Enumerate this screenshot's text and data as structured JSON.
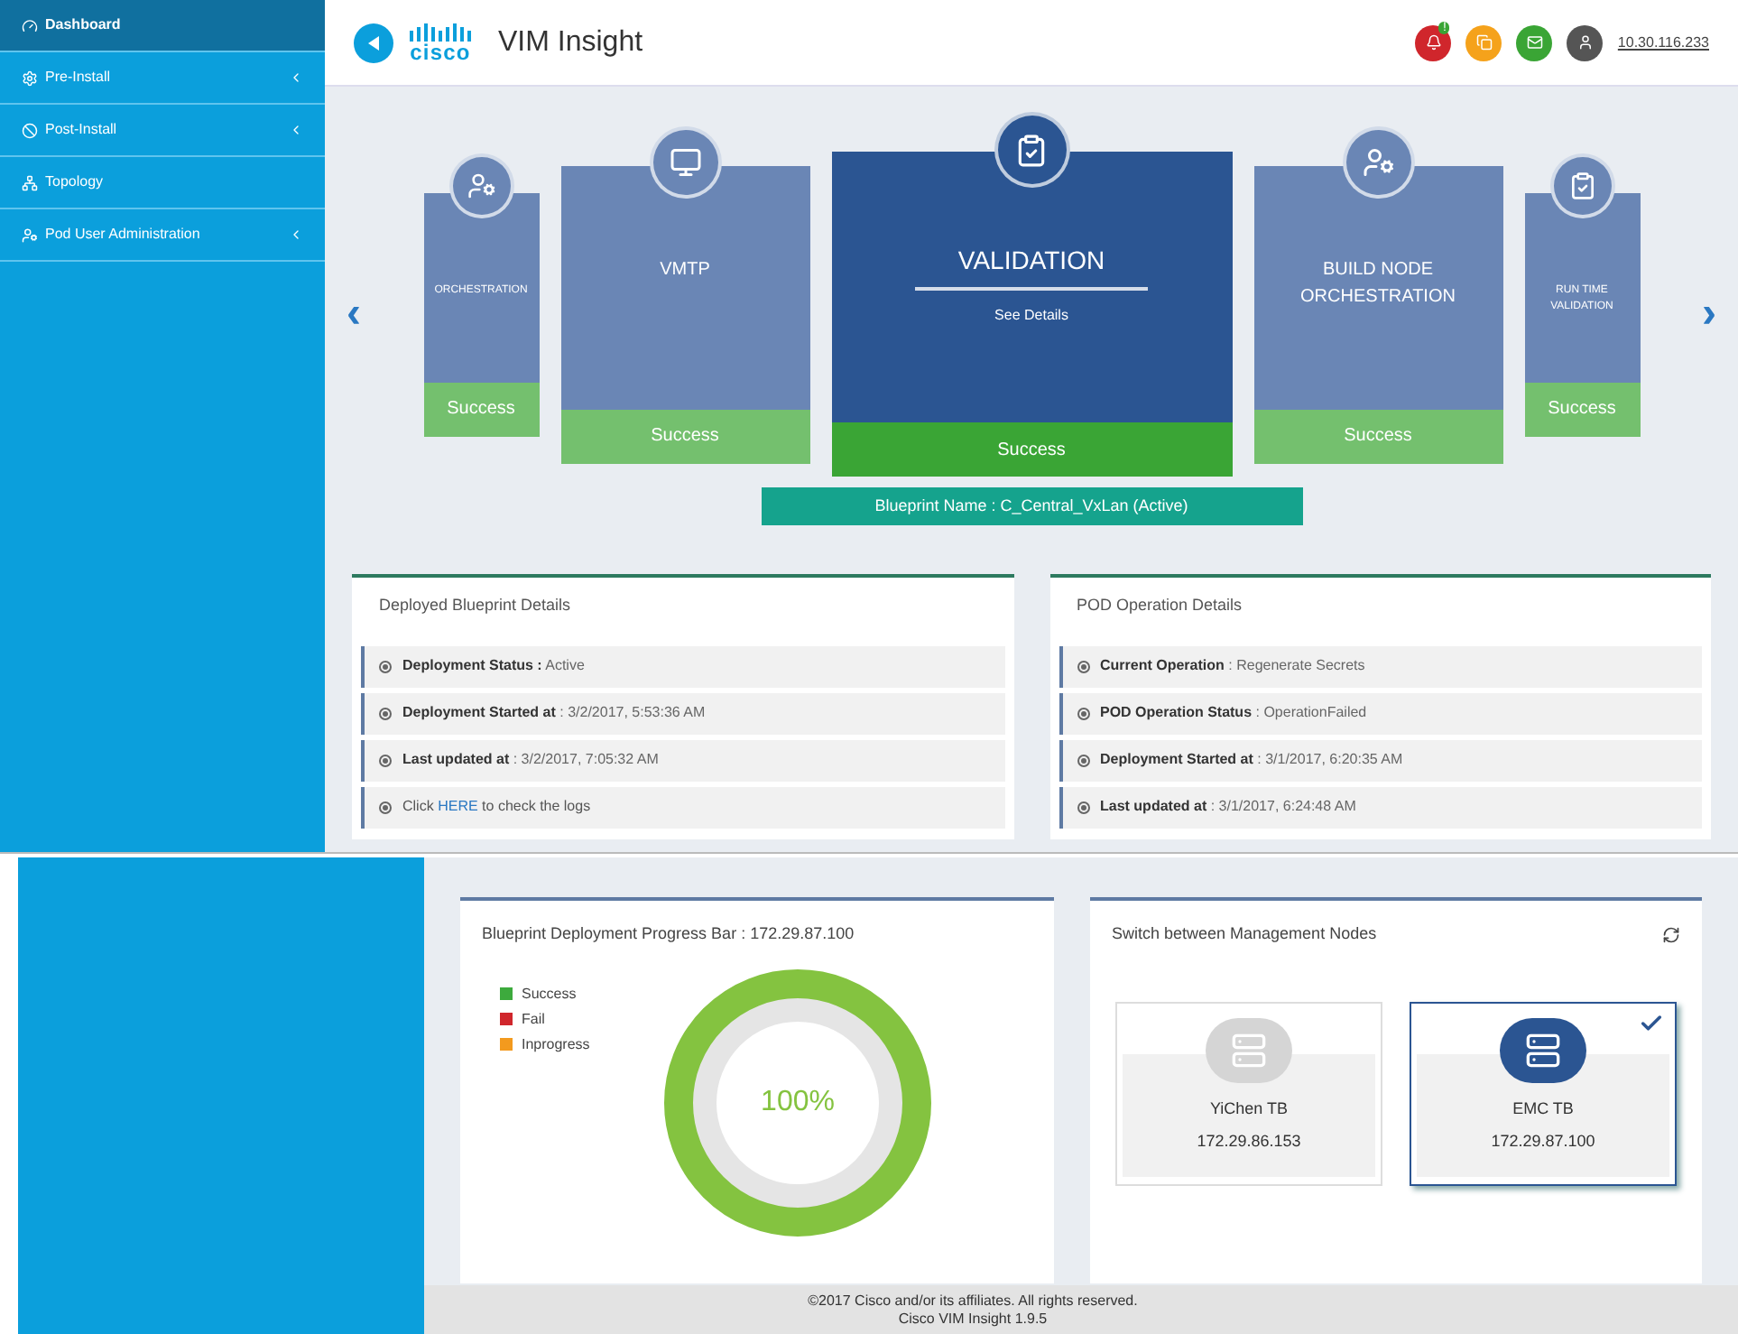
{
  "sidebar": {
    "items": [
      {
        "label": "Dashboard",
        "selected": true,
        "expandable": false
      },
      {
        "label": "Pre-Install",
        "selected": false,
        "expandable": true
      },
      {
        "label": "Post-Install",
        "selected": false,
        "expandable": true
      },
      {
        "label": "Topology",
        "selected": false,
        "expandable": false
      },
      {
        "label": "Pod User Administration",
        "selected": false,
        "expandable": true
      }
    ]
  },
  "header": {
    "logo_text": "cisco",
    "title": "VIM Insight",
    "notification_count": "!",
    "ip": "10.30.116.233"
  },
  "carousel": {
    "prev": "‹",
    "next": "›",
    "stages": [
      {
        "name": "ORCHESTRATION",
        "status": "Success",
        "kind": "small",
        "selected": false
      },
      {
        "name": "VMTP",
        "status": "Success",
        "kind": "medium",
        "selected": false
      },
      {
        "name": "VALIDATION",
        "status": "Success",
        "kind": "large",
        "selected": true,
        "link": "See Details"
      },
      {
        "name": "BUILD NODE ORCHESTRATION",
        "status": "Success",
        "kind": "medium",
        "selected": false
      },
      {
        "name": "RUN TIME VALIDATION",
        "status": "Success",
        "kind": "small",
        "selected": false
      }
    ],
    "blueprint": "Blueprint Name : C_Central_VxLan (Active)"
  },
  "panels": [
    {
      "title": "Deployed Blueprint Details",
      "rows": [
        {
          "kind": "field",
          "label": "Deployment Status :",
          "value": "Active"
        },
        {
          "kind": "field",
          "label": "Deployment Started at",
          "value": ": 3/2/2017, 5:53:36 AM"
        },
        {
          "kind": "field",
          "label": "Last updated at",
          "value": ": 3/2/2017, 7:05:32 AM"
        },
        {
          "kind": "link",
          "before": "Click",
          "link": "HERE",
          "after": "to check the logs"
        }
      ]
    },
    {
      "title": "POD Operation Details",
      "rows": [
        {
          "kind": "field",
          "label": "Current Operation",
          "value": ": Regenerate Secrets"
        },
        {
          "kind": "field",
          "label": "POD Operation Status",
          "value": ": OperationFailed"
        },
        {
          "kind": "field",
          "label": "Deployment Started at",
          "value": ": 3/1/2017, 6:20:35 AM"
        },
        {
          "kind": "field",
          "label": "Last updated at",
          "value": ": 3/1/2017, 6:24:48 AM"
        }
      ]
    }
  ],
  "progress": {
    "title": "Blueprint Deployment Progress Bar : 172.29.87.100",
    "legend": [
      {
        "label": "Success",
        "color": "#3daa3d"
      },
      {
        "label": "Fail",
        "color": "#d0262c"
      },
      {
        "label": "Inprogress",
        "color": "#f39a1e"
      }
    ],
    "level": 1,
    "reading": "100%"
  },
  "nodes": {
    "title": "Switch between Management Nodes",
    "items": [
      {
        "name": "YiChen TB",
        "ip": "172.29.86.153",
        "selected": false
      },
      {
        "name": "EMC TB",
        "ip": "172.29.87.100",
        "selected": true
      }
    ]
  },
  "footer": {
    "copyright": "©2017 Cisco and/or its affiliates. All rights reserved.",
    "version": "Cisco VIM Insight 1.9.5"
  }
}
